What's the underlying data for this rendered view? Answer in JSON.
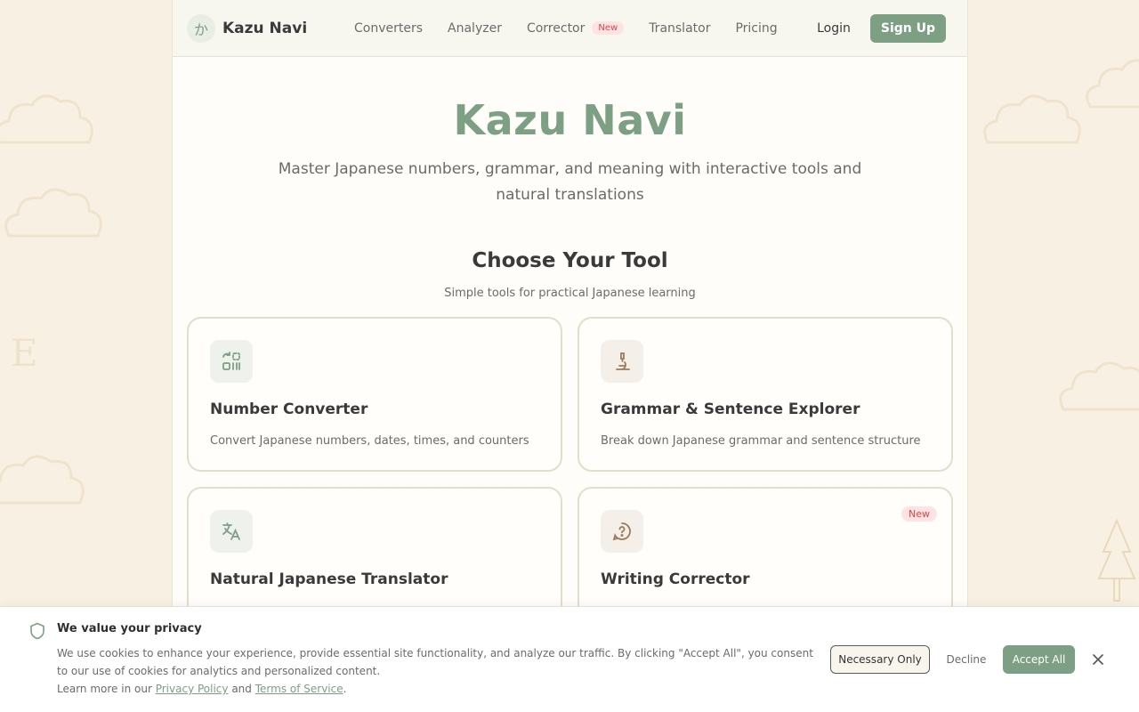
{
  "nav": {
    "brand_mark": "か",
    "brand_name": "Kazu Navi",
    "links": [
      "Converters",
      "Analyzer",
      "Corrector",
      "Translator",
      "Pricing"
    ],
    "new_badge": "New",
    "login": "Login",
    "signup": "Sign Up"
  },
  "hero": {
    "title": "Kazu Navi",
    "subtitle": "Master Japanese numbers, grammar, and meaning with interactive tools and natural translations"
  },
  "tools": {
    "heading": "Choose Your Tool",
    "subheading": "Simple tools for practical Japanese learning",
    "cards": [
      {
        "title": "Number Converter",
        "desc": "Convert Japanese numbers, dates, times, and counters",
        "icon": "convert-icon"
      },
      {
        "title": "Grammar & Sentence Explorer",
        "desc": "Break down Japanese grammar and sentence structure",
        "icon": "microscope-icon"
      },
      {
        "title": "Natural Japanese Translator",
        "desc": "",
        "icon": "translate-icon"
      },
      {
        "title": "Writing Corrector",
        "desc": "",
        "icon": "help-bubble-icon",
        "badge": "New"
      }
    ]
  },
  "cookie": {
    "title": "We value your privacy",
    "text": "We use cookies to enhance your experience, provide essential site functionality, and analyze our traffic. By clicking \"Accept All\", you consent to our use of cookies for analytics and personalized content.",
    "learn_prefix": "Learn more in our",
    "privacy": "Privacy Policy",
    "and": "and",
    "terms": "Terms of Service",
    "period": ".",
    "necessary": "Necessary Only",
    "decline": "Decline",
    "accept": "Accept All"
  },
  "colors": {
    "accent": "#7d9f84",
    "background": "#f8f1e3",
    "badge_text": "#d94646",
    "badge_bg": "#fde3e3"
  }
}
